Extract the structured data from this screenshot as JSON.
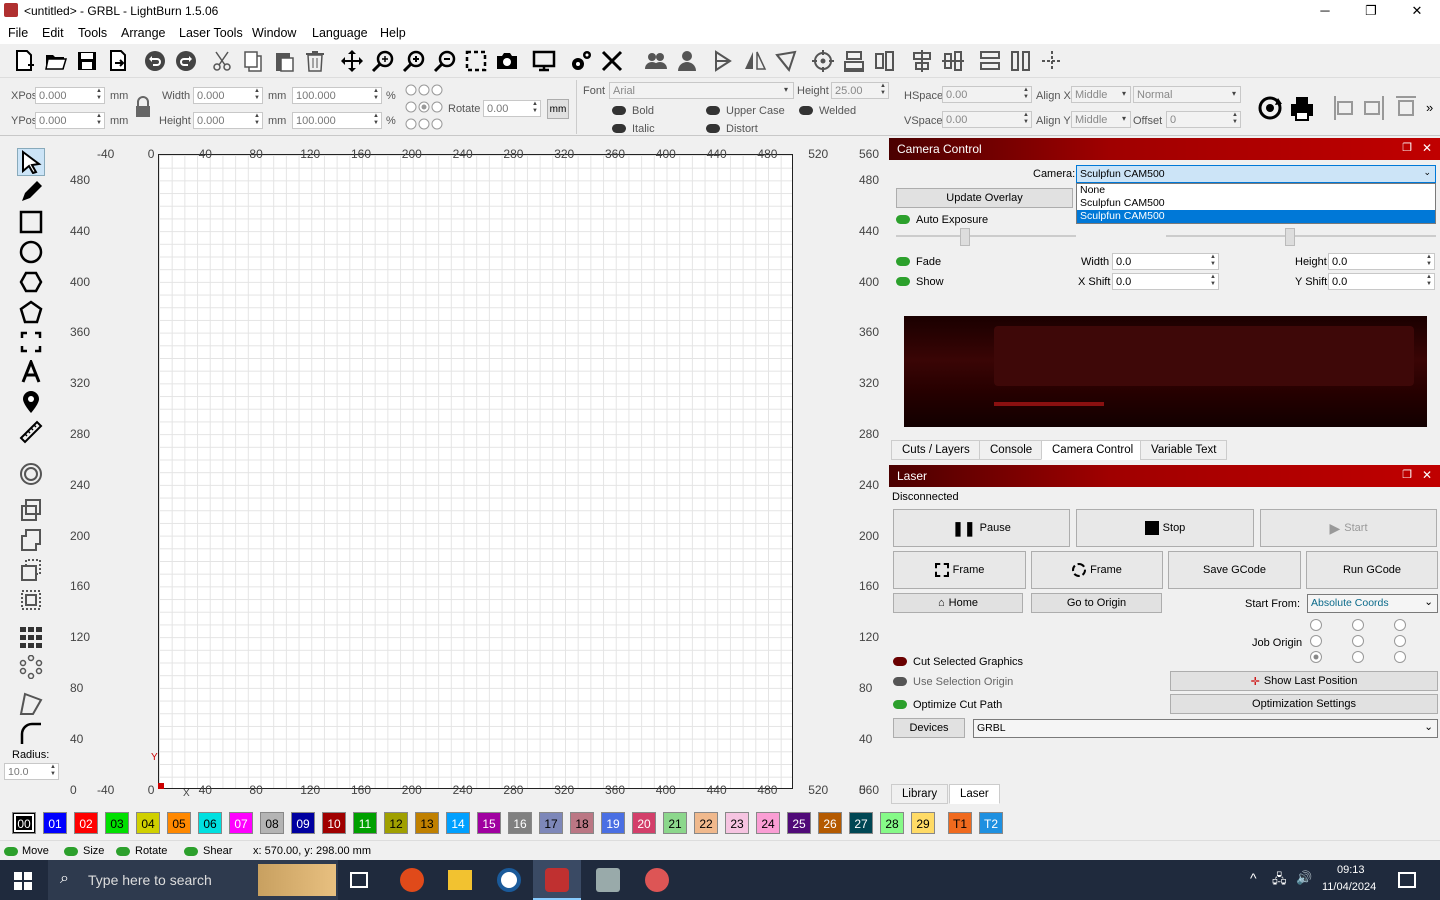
{
  "window": {
    "title": "<untitled> - GRBL - LightBurn 1.5.06",
    "minimize": "─",
    "maximize": "❐",
    "close": "✕"
  },
  "menu": [
    "File",
    "Edit",
    "Tools",
    "Arrange",
    "Laser Tools",
    "Window",
    "Language",
    "Help"
  ],
  "props": {
    "xpos_label": "XPos",
    "xpos": "0.000",
    "ypos_label": "YPos",
    "ypos": "0.000",
    "unit": "mm",
    "width_label": "Width",
    "width": "0.000",
    "height_label": "Height",
    "height": "0.000",
    "wpct": "100.000",
    "hpct": "100.000",
    "pct": "%",
    "rotate_label": "Rotate",
    "rotate": "0.00",
    "mm_btn": "mm",
    "font_label": "Font",
    "font": "Arial",
    "fheight_label": "Height",
    "fheight": "25.00",
    "bold": "Bold",
    "italic": "Italic",
    "upper": "Upper Case",
    "distort": "Distort",
    "welded": "Welded",
    "hspace_label": "HSpace",
    "hspace": "0.00",
    "vspace_label": "VSpace",
    "vspace": "0.00",
    "alignx_label": "Align X",
    "alignx": "Middle",
    "aligny_label": "Align Y",
    "aligny": "Middle",
    "normal": "Normal",
    "offset_label": "Offset",
    "offset": "0"
  },
  "rulers": {
    "top": [
      "-40",
      "0",
      "40",
      "80",
      "120",
      "160",
      "200",
      "240",
      "280",
      "320",
      "360",
      "400",
      "440",
      "480",
      "520",
      "560"
    ],
    "left": [
      "480",
      "440",
      "400",
      "360",
      "320",
      "280",
      "240",
      "200",
      "160",
      "120",
      "80",
      "40",
      "0"
    ],
    "right": [
      "480",
      "440",
      "400",
      "360",
      "320",
      "280",
      "240",
      "200",
      "160",
      "120",
      "80",
      "40",
      "0"
    ],
    "bottom": [
      "-40",
      "0",
      "40",
      "80",
      "120",
      "160",
      "200",
      "240",
      "280",
      "320",
      "360",
      "400",
      "440",
      "480",
      "520",
      "560"
    ],
    "x_label": "X",
    "y_label": "Y"
  },
  "radius": {
    "label": "Radius:",
    "value": "10.0"
  },
  "camera": {
    "title": "Camera Control",
    "camera_label": "Camera:",
    "selected": "Sculpfun CAM500",
    "options": [
      "None",
      "Sculpfun CAM500",
      "Sculpfun CAM500"
    ],
    "update_overlay": "Update Overlay",
    "auto_exposure": "Auto Exposure",
    "fade": "Fade",
    "show": "Show",
    "width_label": "Width",
    "width": "0.0",
    "height_label": "Height",
    "height": "0.0",
    "xshift_label": "X Shift",
    "xshift": "0.0",
    "yshift_label": "Y Shift",
    "yshift": "0.0"
  },
  "tabs1": [
    "Cuts / Layers",
    "Console",
    "Camera Control",
    "Variable Text"
  ],
  "laser": {
    "title": "Laser",
    "status": "Disconnected",
    "pause": "Pause",
    "stop": "Stop",
    "start": "Start",
    "frame1": "Frame",
    "frame2": "Frame",
    "save_gcode": "Save GCode",
    "run_gcode": "Run GCode",
    "home": "Home",
    "go_origin": "Go to Origin",
    "start_from_label": "Start From:",
    "start_from": "Absolute Coords",
    "job_origin": "Job Origin",
    "cut_selected": "Cut Selected Graphics",
    "use_selection": "Use Selection Origin",
    "optimize": "Optimize Cut Path",
    "show_last": "Show Last Position",
    "opt_settings": "Optimization Settings",
    "devices": "Devices",
    "device": "GRBL"
  },
  "tabs2": [
    "Library",
    "Laser"
  ],
  "palette": [
    {
      "l": "00",
      "c": "#000000",
      "t": "#ffffff"
    },
    {
      "l": "01",
      "c": "#0000ff",
      "t": "#ffffff"
    },
    {
      "l": "02",
      "c": "#ff0000",
      "t": "#ffffff"
    },
    {
      "l": "03",
      "c": "#00e000",
      "t": "#000000"
    },
    {
      "l": "04",
      "c": "#d0d000",
      "t": "#000000"
    },
    {
      "l": "05",
      "c": "#ff8800",
      "t": "#000000"
    },
    {
      "l": "06",
      "c": "#00e0e0",
      "t": "#000000"
    },
    {
      "l": "07",
      "c": "#ff00ff",
      "t": "#ffffff"
    },
    {
      "l": "08",
      "c": "#b4b4b4",
      "t": "#000000"
    },
    {
      "l": "09",
      "c": "#0000a0",
      "t": "#ffffff"
    },
    {
      "l": "10",
      "c": "#a00000",
      "t": "#ffffff"
    },
    {
      "l": "11",
      "c": "#00a000",
      "t": "#ffffff"
    },
    {
      "l": "12",
      "c": "#a0a000",
      "t": "#000000"
    },
    {
      "l": "13",
      "c": "#c08000",
      "t": "#000000"
    },
    {
      "l": "14",
      "c": "#00a0ff",
      "t": "#ffffff"
    },
    {
      "l": "15",
      "c": "#a000a0",
      "t": "#ffffff"
    },
    {
      "l": "16",
      "c": "#808080",
      "t": "#ffffff"
    },
    {
      "l": "17",
      "c": "#7d87b9",
      "t": "#000000"
    },
    {
      "l": "18",
      "c": "#bb7784",
      "t": "#000000"
    },
    {
      "l": "19",
      "c": "#4a6fe3",
      "t": "#ffffff"
    },
    {
      "l": "20",
      "c": "#d33f6a",
      "t": "#ffffff"
    },
    {
      "l": "21",
      "c": "#8cd78c",
      "t": "#000000"
    },
    {
      "l": "22",
      "c": "#f0b98d",
      "t": "#000000"
    },
    {
      "l": "23",
      "c": "#f6c4e1",
      "t": "#000000"
    },
    {
      "l": "24",
      "c": "#fa9ed4",
      "t": "#000000"
    },
    {
      "l": "25",
      "c": "#500a78",
      "t": "#ffffff"
    },
    {
      "l": "26",
      "c": "#b45a00",
      "t": "#ffffff"
    },
    {
      "l": "27",
      "c": "#004754",
      "t": "#ffffff"
    },
    {
      "l": "28",
      "c": "#86fa88",
      "t": "#000000"
    },
    {
      "l": "29",
      "c": "#ffdb66",
      "t": "#000000"
    },
    {
      "l": "T1",
      "c": "#f06a1e",
      "t": "#000000"
    },
    {
      "l": "T2",
      "c": "#1e90e0",
      "t": "#ffffff"
    }
  ],
  "status": {
    "move": "Move",
    "size": "Size",
    "rotate": "Rotate",
    "shear": "Shear",
    "coords": "x: 570.00, y: 298.00 mm"
  },
  "taskbar": {
    "search": "Type here to search",
    "time": "09:13",
    "date": "11/04/2024"
  }
}
